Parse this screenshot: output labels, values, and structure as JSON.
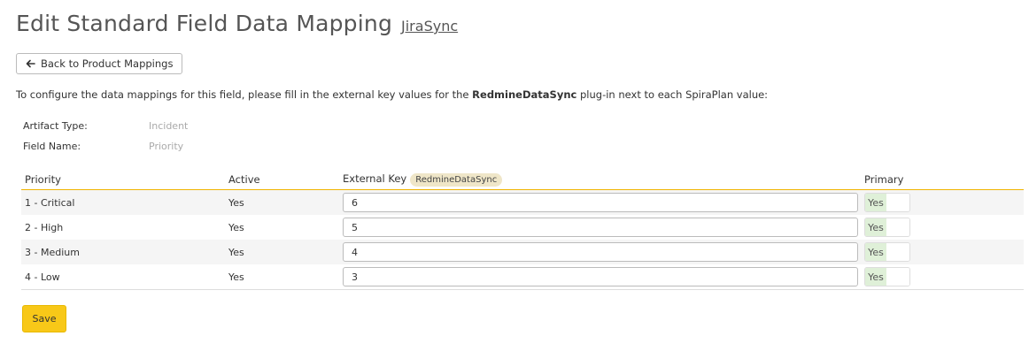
{
  "header": {
    "title": "Edit Standard Field Data Mapping",
    "plugin_link": "JiraSync"
  },
  "back_button": {
    "label": "Back to Product Mappings",
    "icon": "arrow-left-icon"
  },
  "intro": {
    "before": "To configure the data mappings for this field, please fill in the external key values for the ",
    "plugin": "RedmineDataSync",
    "after": " plug-in next to each SpiraPlan value:"
  },
  "meta": {
    "artifact_type_label": "Artifact Type:",
    "artifact_type_value": "Incident",
    "field_name_label": "Field Name:",
    "field_name_value": "Priority"
  },
  "table": {
    "headers": {
      "priority": "Priority",
      "active": "Active",
      "external_key": "External Key",
      "external_key_badge": "RedmineDataSync",
      "primary": "Primary"
    },
    "rows": [
      {
        "priority": "1 - Critical",
        "active": "Yes",
        "external_key": "6",
        "primary": "Yes"
      },
      {
        "priority": "2 - High",
        "active": "Yes",
        "external_key": "5",
        "primary": "Yes"
      },
      {
        "priority": "3 - Medium",
        "active": "Yes",
        "external_key": "4",
        "primary": "Yes"
      },
      {
        "priority": "4 - Low",
        "active": "Yes",
        "external_key": "3",
        "primary": "Yes"
      }
    ]
  },
  "save_button": {
    "label": "Save"
  },
  "colors": {
    "accent": "#f8c818",
    "header_rule": "#f0b400",
    "toggle_on": "#dff0d8",
    "badge": "#efe6c8"
  }
}
